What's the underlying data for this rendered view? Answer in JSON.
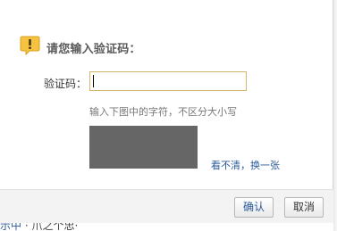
{
  "prompt": {
    "title": "请您输入验证码：",
    "icon": "exclamation-icon"
  },
  "form": {
    "code_label": "验证码：",
    "code_value": "",
    "code_placeholder": "",
    "hint": "输入下图中的字符，不区分大小写",
    "refresh_link": "看不清，换一张"
  },
  "footer": {
    "confirm_label": "确认",
    "cancel_label": "取消"
  },
  "background_page": {
    "text_link_part": "示中",
    "text_rest": " · 爪之个忠·"
  },
  "colors": {
    "accent": "#2a5b9a",
    "input_border": "#d5b56a",
    "icon_fill": "#f5c242",
    "captcha_bg": "#666666"
  }
}
